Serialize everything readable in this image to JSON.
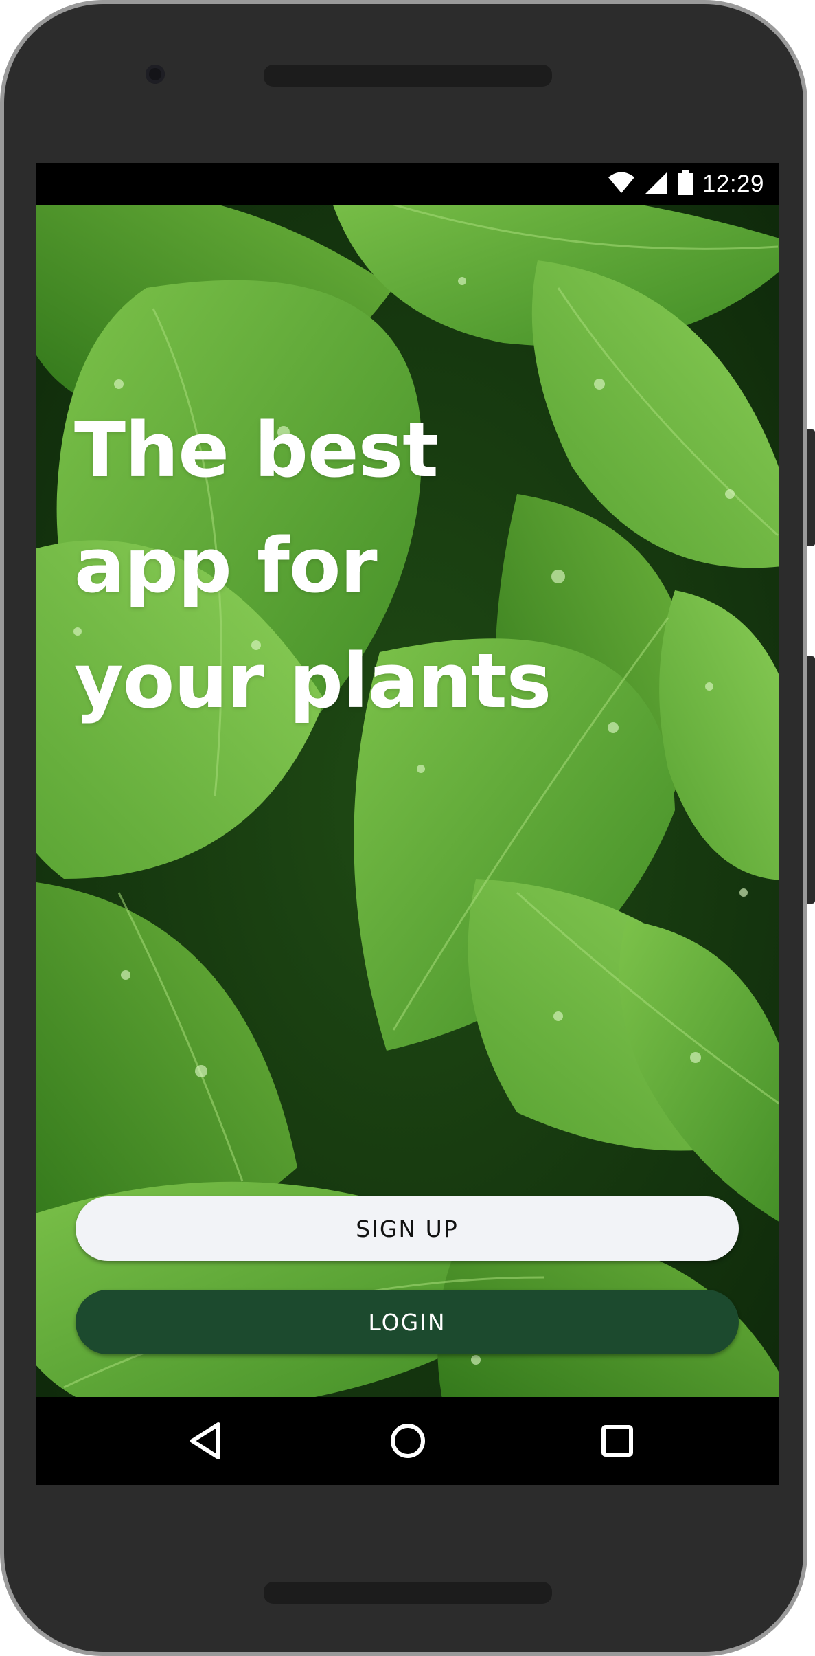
{
  "status_bar": {
    "time": "12:29",
    "icons": [
      "wifi-icon",
      "signal-icon",
      "battery-icon"
    ]
  },
  "welcome": {
    "headline_lines": [
      "The best",
      "app for",
      "your plants"
    ],
    "signup_label": "SIGN UP",
    "login_label": "LOGIN"
  },
  "nav_bar": {
    "icons": [
      "back-icon",
      "home-icon",
      "recents-icon"
    ]
  },
  "colors": {
    "device_frame": "#2c2c2c",
    "signup_button_bg": "#f2f3f7",
    "login_button_bg": "#1c4a2e",
    "leaf_green": "#4e9a2c"
  }
}
